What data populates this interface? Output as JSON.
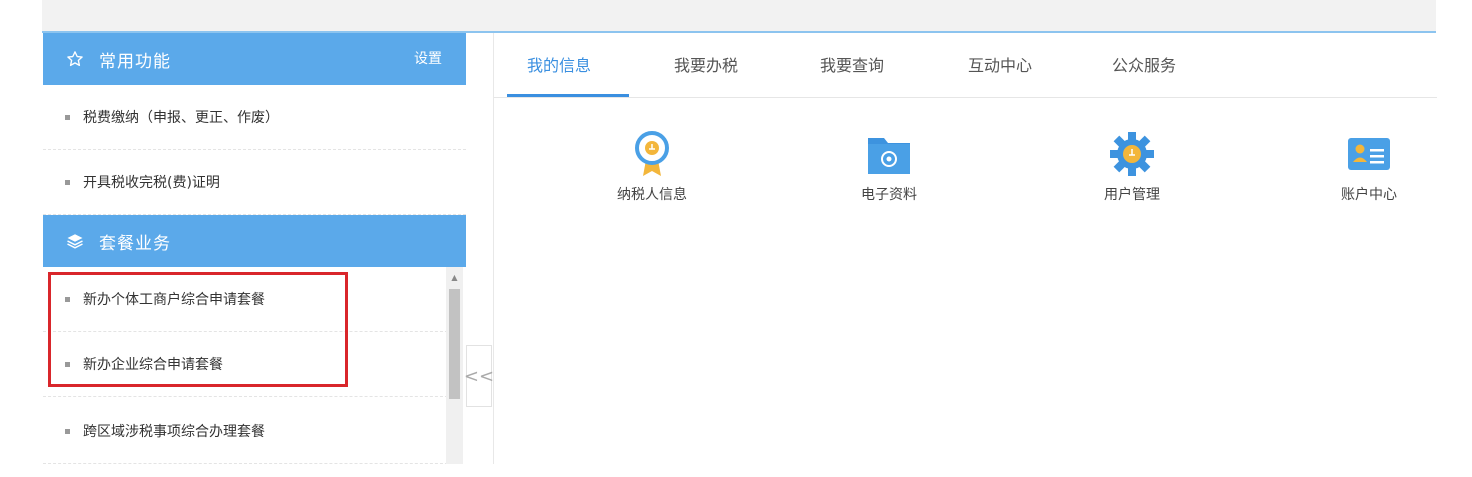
{
  "left_panel": {
    "common": {
      "title": "常用功能",
      "settings_link": "设置",
      "items": [
        {
          "label": "税费缴纳（申报、更正、作废）"
        },
        {
          "label": "开具税收完税(费)证明"
        }
      ]
    },
    "packages": {
      "title": "套餐业务",
      "items": [
        {
          "label": "新办个体工商户综合申请套餐"
        },
        {
          "label": "新办企业综合申请套餐"
        },
        {
          "label": "跨区域涉税事项综合办理套餐"
        }
      ]
    },
    "collapse_label": "<<"
  },
  "tabs": [
    {
      "label": "我的信息",
      "active": true
    },
    {
      "label": "我要办税"
    },
    {
      "label": "我要查询"
    },
    {
      "label": "互动中心"
    },
    {
      "label": "公众服务"
    }
  ],
  "tiles": [
    {
      "label": "纳税人信息",
      "icon": "taxpayer-info-icon"
    },
    {
      "label": "电子资料",
      "icon": "electronic-docs-icon"
    },
    {
      "label": "用户管理",
      "icon": "user-management-icon"
    },
    {
      "label": "账户中心",
      "icon": "account-center-icon"
    }
  ],
  "colors": {
    "header_blue": "#5ba9ea",
    "tab_active": "#3a8fe0",
    "highlight_red": "#d9262b"
  }
}
